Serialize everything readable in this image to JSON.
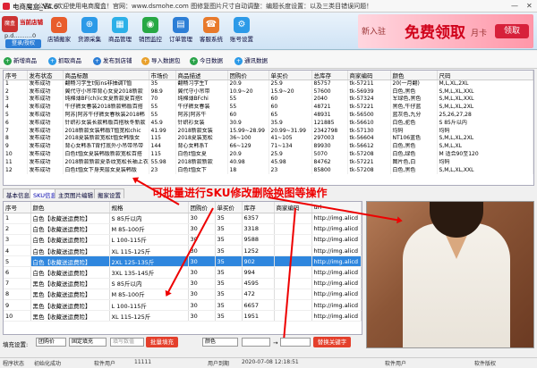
{
  "window": {
    "title": "电商魔盒_V4.6",
    "minimize": "—",
    "close": "✕"
  },
  "notice": "公告：欢迎使用电商魔盒！官网：www.dsmohe.com  图修复图片尺寸自动调整：编题长度设置：以及三类目错误问题！",
  "user": {
    "shop_label": "当前店铺",
    "username": "p.d..........0",
    "login_button": "登录/授权",
    "avatar": "魔盒"
  },
  "nav": [
    {
      "label": "店铺搬家",
      "icon": "store-icon",
      "color": "#e85d2c"
    },
    {
      "label": "货源采集",
      "icon": "collect-icon",
      "color": "#2c9ae8"
    },
    {
      "label": "商品管理",
      "icon": "goods-icon",
      "color": "#2cb0e8"
    },
    {
      "label": "销团监控",
      "icon": "monitor-icon",
      "color": "#27a844"
    },
    {
      "label": "订单管理",
      "icon": "orders-icon",
      "color": "#2c7ed6"
    },
    {
      "label": "客服系统",
      "icon": "service-icon",
      "color": "#e87a2c"
    },
    {
      "label": "账号设置",
      "icon": "settings-icon",
      "color": "#2c9ae8"
    }
  ],
  "promo": {
    "a": "新入驻",
    "b": "免费领取",
    "c": "月卡",
    "d": "领取"
  },
  "toolbar": [
    {
      "label": "新增商品",
      "icon": "add-icon",
      "color": "#2aa34a"
    },
    {
      "label": "抓取商品",
      "icon": "grab-icon",
      "color": "#2c9ae8"
    },
    {
      "label": "发布到店铺",
      "icon": "publish-icon",
      "color": "#2c7ed6"
    },
    {
      "label": "导入数据包",
      "icon": "import-icon",
      "color": "#e8a02c"
    },
    {
      "label": "今日数据",
      "icon": "today-icon",
      "color": "#2aa34a"
    },
    {
      "label": "通讯数据",
      "icon": "comm-icon",
      "color": "#2c9ae8"
    }
  ],
  "grid1": {
    "columns": [
      "序号",
      "发布状态",
      "商品标题",
      "市场价",
      "商品描述",
      "团购价",
      "单买价",
      "总库存",
      "商家编码",
      "颜色",
      "尺码"
    ],
    "rows": [
      [
        "1",
        "发布成功",
        "翻畅习学生t侃ins非抽调T恤",
        "35",
        "翻畅习学生T",
        "20.9",
        "25.9",
        "85757",
        "tk-57211",
        "20(一月翻)",
        "M,L,XL,2XL"
      ],
      [
        "2",
        "发布成功",
        "翼代守小吊带背心女夏2018新款",
        "98.9",
        "翼代守小吊带",
        "10.9~20",
        "15.9~20",
        "57600",
        "tk-56939",
        "白色,黑色",
        "S,M,L,XL,XXL"
      ],
      [
        "3",
        "发布成功",
        "纯棉薄BF(ch)ic女夏新款夏百搭t",
        "70",
        "纯棉薄BFchi",
        "55",
        "60",
        "2040",
        "tk-57324",
        "军绿色,黑色",
        "S,M,L,XL,XXL"
      ],
      [
        "4",
        "发布成功",
        "牛仔裤女春装2018新款韩版百搭",
        "55",
        "牛仔裤女春装",
        "55",
        "60",
        "48721",
        "tk-57221",
        "黑色,牛仔蓝",
        "S,M,L,XL,2XL"
      ],
      [
        "5",
        "发布成功",
        "阿苏|阿苏牛仔裤女春秋装2018韩",
        "55",
        "阿苏|阿苏牛",
        "60",
        "65",
        "48931",
        "tk-56500",
        "蓝灰色,九分",
        "25,26,27,28"
      ],
      [
        "6",
        "发布成功",
        "针织衫女装长款韩版百搭秋冬新款",
        "45.9",
        "针织衫女装",
        "30.9",
        "35.9",
        "121885",
        "tk-56610",
        "白色,驼色",
        "S 85斤以内"
      ],
      [
        "7",
        "发布成功",
        "2018新款女装韩版T恤宽松chic",
        "41.99",
        "2018新款女装",
        "15.99~28.99",
        "20.99~31.99",
        "2342798",
        "tk-57130",
        "均码",
        "均码"
      ],
      [
        "8",
        "发布成功",
        "2018夏装新款宽松t恤女韩版女",
        "115",
        "2018夏装宽松",
        "36~100",
        "41~105",
        "297003",
        "tk-56604",
        "NT106蓝色",
        "S,M,L,XL,2XL"
      ],
      [
        "9",
        "发布成功",
        "背心女韩系T背打底外小吊带吊带",
        "144",
        "背心女韩系T",
        "66~129",
        "71~134",
        "89930",
        "tk-56612",
        "白色,黑色",
        "S,M,L,XL"
      ],
      [
        "10",
        "发布成功",
        "白色t恤女夏装韩版新款宽松百搭",
        "115",
        "白色t恤女夏",
        "20.9",
        "25.9",
        "5070",
        "tk-57208",
        "白色,绿色",
        "M 适合90至120"
      ],
      [
        "11",
        "发布成功",
        "2018新款新款夏条纹宽松长袖上衣",
        "55.98",
        "2018新款新款",
        "40.98",
        "45.98",
        "84762",
        "tk-57221",
        "图片色,白",
        "均码"
      ],
      [
        "12",
        "发布成功",
        "白色t恤女下身夹层女夏装韩版",
        "23",
        "白色t恤女下",
        "18",
        "23",
        "85800",
        "tk-57208",
        "白色,黑色",
        "S,M,L,XL,XXL"
      ]
    ]
  },
  "tabs": [
    "基本信息",
    "SKU信息",
    "主页图片编辑",
    "搬家设置"
  ],
  "annotation": "可批量进行SKU修改删除换图等操作",
  "grid2": {
    "columns": [
      "序号",
      "颜色",
      "规格",
      "团购价",
      "单买价",
      "库存",
      "商家编码",
      "url"
    ],
    "selected_index": 4,
    "rows": [
      [
        "1",
        "白色【收藏送运费险】",
        "S 85斤以内",
        "30",
        "35",
        "6357",
        "",
        "http://img.alicd"
      ],
      [
        "2",
        "白色【收藏送运费险】",
        "M 85-100斤",
        "30",
        "35",
        "3318",
        "",
        "http://img.alicd"
      ],
      [
        "3",
        "白色【收藏送运费险】",
        "L 100-115斤",
        "30",
        "35",
        "9588",
        "",
        "http://img.alicd"
      ],
      [
        "4",
        "白色【收藏送运费险】",
        "XL 115-125斤",
        "30",
        "35",
        "1252",
        "",
        "http://img.alicd"
      ],
      [
        "5",
        "白色【收藏送运费险】",
        "2XL 125-135斤",
        "30",
        "35",
        "902",
        "",
        "http://img.alicd"
      ],
      [
        "6",
        "白色【收藏送运费险】",
        "3XL 135-145斤",
        "30",
        "35",
        "994",
        "",
        "http://img.alicd"
      ],
      [
        "7",
        "黑色【收藏送运费险】",
        "S 85斤以内",
        "30",
        "35",
        "4595",
        "",
        "http://img.alicd"
      ],
      [
        "8",
        "黑色【收藏送运费险】",
        "M 85-100斤",
        "30",
        "35",
        "472",
        "",
        "http://img.alicd"
      ],
      [
        "9",
        "黑色【收藏送运费险】",
        "L 100-115斤",
        "30",
        "35",
        "6657",
        "",
        "http://img.alicd"
      ],
      [
        "10",
        "黑色【收藏送运费险】",
        "XL 115-125斤",
        "30",
        "35",
        "1951",
        "",
        "http://img.alicd"
      ]
    ]
  },
  "fill": {
    "label": "填充设置:",
    "dd1": "团购价",
    "dd2": "固定填充",
    "input": "填写数值",
    "fill_btn": "批量填充",
    "color_dd": "颜色",
    "arrow": "→",
    "replace_btn": "替换关键字"
  },
  "status": {
    "a": "程序状态",
    "b": "初始化成功",
    "c": "软件用户",
    "d": "11111",
    "e": "用户到期",
    "f": "2020-07-08 12:18:51",
    "g": "软件用户",
    "h": "软件版权"
  }
}
